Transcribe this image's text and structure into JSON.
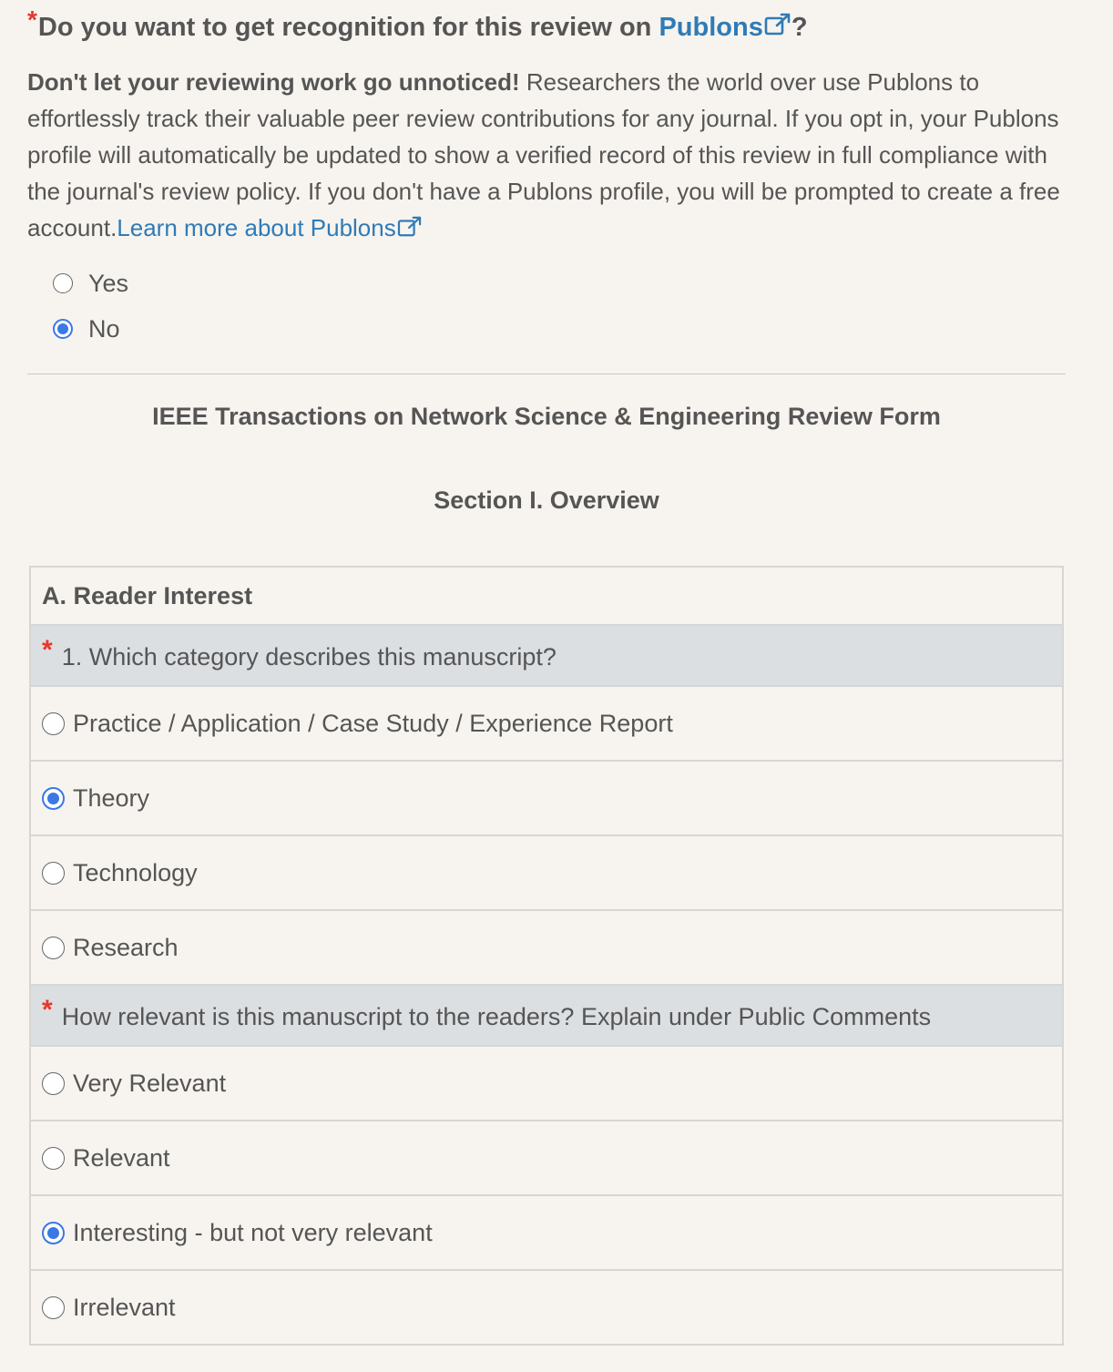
{
  "publons": {
    "question_prefix": "Do you want to get recognition for this review on ",
    "question_link": "Publons",
    "question_suffix": "?",
    "intro_bold": "Don't let your reviewing work go unnoticed!",
    "intro_text": " Researchers the world over use Publons to effortlessly track their valuable peer review contributions for any journal. If you opt in, your Publons profile will automatically be updated to show a verified record of this review in full compliance with the journal's review policy. If you don't have a Publons profile, you will be prompted to create a free account.",
    "learn_more_link": "Learn more about Publons",
    "options": [
      {
        "label": "Yes",
        "checked": false
      },
      {
        "label": "No",
        "checked": true
      }
    ]
  },
  "form": {
    "title": "IEEE Transactions on Network Science & Engineering Review Form",
    "section_title": "Section I. Overview",
    "group_title": "A. Reader Interest",
    "q1": {
      "text": "1. Which category describes this manuscript?",
      "options": [
        {
          "label": "Practice / Application / Case Study / Experience Report",
          "checked": false
        },
        {
          "label": "Theory",
          "checked": true
        },
        {
          "label": "Technology",
          "checked": false
        },
        {
          "label": "Research",
          "checked": false
        }
      ]
    },
    "q2": {
      "text": "How relevant is this manuscript to the readers? Explain under Public Comments",
      "options": [
        {
          "label": "Very Relevant",
          "checked": false
        },
        {
          "label": "Relevant",
          "checked": false
        },
        {
          "label": "Interesting - but not very relevant",
          "checked": true
        },
        {
          "label": "Irrelevant",
          "checked": false
        }
      ]
    }
  },
  "icons": {
    "required": "*",
    "external_link": "external-link-icon"
  },
  "colors": {
    "link": "#2f7bb7",
    "required": "#e8362c",
    "radio_checked": "#3a78e6",
    "question_bg": "#dcdfe2",
    "page_bg": "#f7f4ef"
  }
}
